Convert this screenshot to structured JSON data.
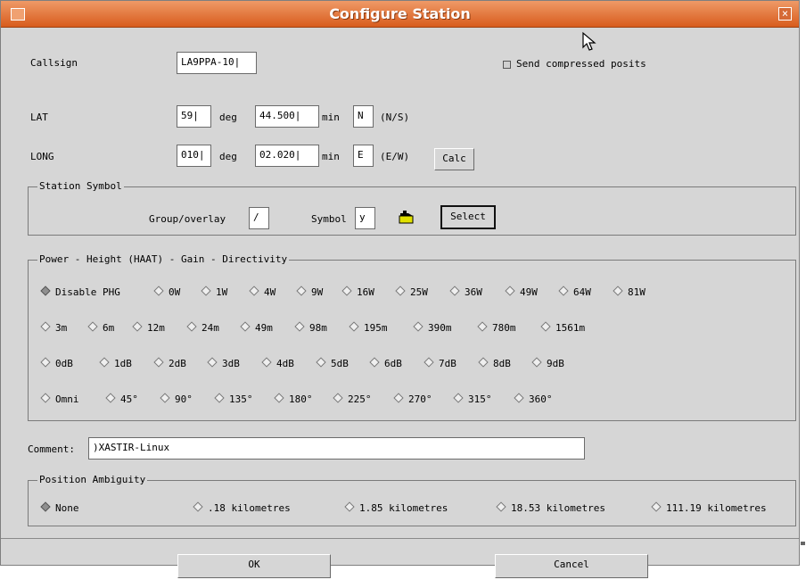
{
  "window": {
    "title": "Configure Station"
  },
  "form": {
    "callsign_label": "Callsign",
    "callsign_value": "LA9PPA-10",
    "send_compressed_label": "Send compressed posits",
    "lat_label": "LAT",
    "lat_deg": "59",
    "deg_label": "deg",
    "lat_min": "44.500",
    "min_label": "min",
    "lat_hemi": "N",
    "lat_hemi_hint": "(N/S)",
    "long_label": "LONG",
    "long_deg": "010",
    "long_min": "02.020",
    "long_hemi": "E",
    "long_hemi_hint": "(E/W)",
    "calc_label": "Calc"
  },
  "symbol": {
    "title": "Station Symbol",
    "group_label": "Group/overlay",
    "group_value": "/",
    "symbol_label": "Symbol",
    "symbol_value": "y",
    "select_label": "Select"
  },
  "phg": {
    "title": "Power - Height (HAAT) - Gain - Directivity",
    "rows": [
      [
        "Disable PHG",
        "0W",
        "1W",
        "4W",
        "9W",
        "16W",
        "25W",
        "36W",
        "49W",
        "64W",
        "81W"
      ],
      [
        "3m",
        "6m",
        "12m",
        "24m",
        "49m",
        "98m",
        "195m",
        "390m",
        "780m",
        "1561m"
      ],
      [
        "0dB",
        "1dB",
        "2dB",
        "3dB",
        "4dB",
        "5dB",
        "6dB",
        "7dB",
        "8dB",
        "9dB"
      ],
      [
        "Omni",
        "45°",
        "90°",
        "135°",
        "180°",
        "225°",
        "270°",
        "315°",
        "360°"
      ]
    ]
  },
  "comment": {
    "label": "Comment:",
    "value": ")XASTIR-Linux"
  },
  "ambiguity": {
    "title": "Position Ambiguity",
    "options": [
      "None",
      ".18 kilometres",
      "1.85 kilometres",
      "18.53 kilometres",
      "111.19 kilometres"
    ]
  },
  "buttons": {
    "ok": "OK",
    "cancel": "Cancel"
  },
  "colors": {
    "titlebar": "#d85c1d",
    "window_bg": "#d6d6d6",
    "field_bg": "#ffffff"
  },
  "icons": {
    "window_menu": "window-menu-icon",
    "close": "close-icon",
    "cursor": "mouse-cursor-icon",
    "symbol_preview": "station-symbol-icon"
  }
}
